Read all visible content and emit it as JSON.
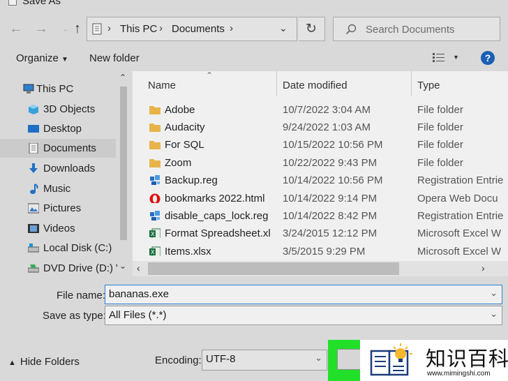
{
  "window": {
    "title": "Save As"
  },
  "address": {
    "crumbs": [
      "This PC",
      "Documents"
    ]
  },
  "search": {
    "placeholder": "Search Documents"
  },
  "toolbar": {
    "organize": "Organize",
    "new_folder": "New folder"
  },
  "nav": {
    "items": [
      {
        "label": "This PC",
        "icon": "this-pc-icon"
      },
      {
        "label": "3D Objects",
        "icon": "3d-objects-icon"
      },
      {
        "label": "Desktop",
        "icon": "desktop-icon"
      },
      {
        "label": "Documents",
        "icon": "documents-icon",
        "selected": true
      },
      {
        "label": "Downloads",
        "icon": "downloads-icon"
      },
      {
        "label": "Music",
        "icon": "music-icon"
      },
      {
        "label": "Pictures",
        "icon": "pictures-icon"
      },
      {
        "label": "Videos",
        "icon": "videos-icon"
      },
      {
        "label": "Local Disk (C:)",
        "icon": "local-disk-icon"
      },
      {
        "label": "DVD Drive (D:) V",
        "icon": "dvd-drive-icon"
      }
    ]
  },
  "files": {
    "columns": [
      "Name",
      "Date modified",
      "Type"
    ],
    "rows": [
      {
        "name": "Adobe",
        "date": "10/7/2022 3:04 AM",
        "type": "File folder",
        "icon": "folder-icon"
      },
      {
        "name": "Audacity",
        "date": "9/24/2022 1:03 AM",
        "type": "File folder",
        "icon": "folder-icon"
      },
      {
        "name": "For SQL",
        "date": "10/15/2022 10:56 PM",
        "type": "File folder",
        "icon": "folder-icon"
      },
      {
        "name": "Zoom",
        "date": "10/22/2022 9:43 PM",
        "type": "File folder",
        "icon": "folder-icon"
      },
      {
        "name": "Backup.reg",
        "date": "10/14/2022 10:56 PM",
        "type": "Registration Entrie",
        "icon": "registry-file-icon"
      },
      {
        "name": "bookmarks 2022.html",
        "date": "10/14/2022 9:14 PM",
        "type": "Opera Web Docu",
        "icon": "opera-icon"
      },
      {
        "name": "disable_caps_lock.reg",
        "date": "10/14/2022 8:42 PM",
        "type": "Registration Entrie",
        "icon": "registry-file-icon"
      },
      {
        "name": "Format Spreadsheet.xl...",
        "date": "3/24/2015 12:12 PM",
        "type": "Microsoft Excel W",
        "icon": "excel-icon"
      },
      {
        "name": "Items.xlsx",
        "date": "3/5/2015 9:29 PM",
        "type": "Microsoft Excel W",
        "icon": "excel-icon"
      }
    ]
  },
  "form": {
    "file_name_label": "File name:",
    "file_name_value": "bananas.exe",
    "save_type_label": "Save as type:",
    "save_type_value": "All Files  (*.*)",
    "encoding_label": "Encoding:",
    "encoding_value": "UTF-8",
    "hide_folders": "Hide Folders"
  },
  "watermark": {
    "text": "知识百科",
    "url": "www.mimingshi.com"
  },
  "colors": {
    "accent": "#1a5fb4",
    "folder": "#e8b44a",
    "highlight": "#22e02a",
    "excel": "#1d7044",
    "opera": "#e01010"
  }
}
